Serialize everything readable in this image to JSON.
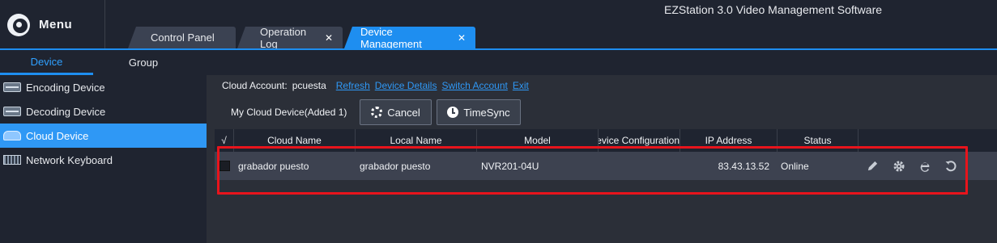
{
  "titlebar": {
    "menu_label": "Menu",
    "app_title": "EZStation 3.0 Video Management Software",
    "tabs": [
      {
        "label": "Control Panel",
        "closable": false,
        "active": false
      },
      {
        "label": "Operation Log",
        "closable": true,
        "active": false
      },
      {
        "label": "Device Management",
        "closable": true,
        "active": true
      }
    ],
    "close_glyph": "✕"
  },
  "left_tabs": {
    "device": "Device",
    "group": "Group"
  },
  "sidebar": {
    "items": [
      {
        "label": "Encoding Device",
        "icon": "encoding-device-icon",
        "active": false
      },
      {
        "label": "Decoding Device",
        "icon": "decoding-device-icon",
        "active": false
      },
      {
        "label": "Cloud Device",
        "icon": "cloud-device-icon",
        "active": true
      },
      {
        "label": "Network Keyboard",
        "icon": "keyboard-icon",
        "active": false
      }
    ]
  },
  "cloud_account": {
    "label": "Cloud Account:",
    "user": "pcuesta",
    "links": [
      "Refresh",
      "Device Details",
      "Switch Account",
      "Exit"
    ]
  },
  "toolbar": {
    "summary": "My Cloud Device(Added 1)",
    "cancel_label": "Cancel",
    "timesync_label": "TimeSync"
  },
  "table": {
    "headers": [
      "√",
      "Cloud Name",
      "Local Name",
      "Model",
      "Device Configuration",
      "IP Address",
      "Status",
      ""
    ],
    "rows": [
      {
        "cloud_name": "grabador puesto",
        "local_name": "grabador puesto",
        "model": "NVR201-04U",
        "device_configuration": "",
        "ip_address": "83.43.13.52",
        "status": "Online",
        "actions": [
          "edit-icon",
          "settings-icon",
          "browser-icon",
          "refresh-icon"
        ]
      }
    ]
  },
  "colors": {
    "accent": "#1e8ef0",
    "highlight_box": "#e8141c",
    "link": "#2f98f5"
  }
}
